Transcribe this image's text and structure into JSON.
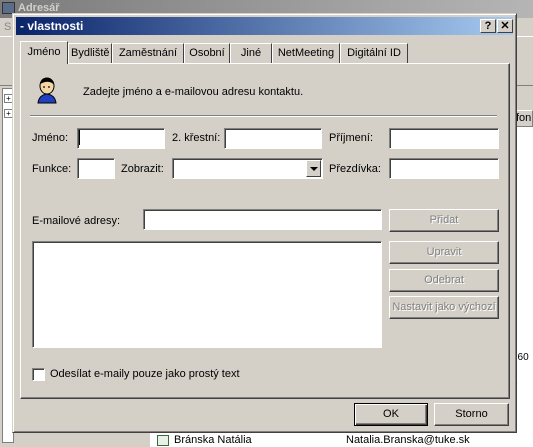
{
  "background": {
    "app_title": "Adresář",
    "menu_fragment": "S",
    "list_header_fragment": "fon",
    "list_fragment_1": ", 60",
    "list_fragment_2": "1",
    "bottom_row": {
      "name": "Bránska Natália",
      "email": "Natalia.Branska@tuke.sk"
    }
  },
  "dialog": {
    "title": "- vlastnosti",
    "help_button": "?",
    "close_button": "✕",
    "tabs": [
      {
        "label": "Jméno",
        "active": true
      },
      {
        "label": "Bydliště"
      },
      {
        "label": "Zaměstnání"
      },
      {
        "label": "Osobní"
      },
      {
        "label": "Jiné"
      },
      {
        "label": "NetMeeting"
      },
      {
        "label": "Digitální ID"
      }
    ],
    "intro_text": "Zadejte jméno a e-mailovou adresu kontaktu.",
    "fields": {
      "first_name": {
        "label": "Jméno:",
        "value": ""
      },
      "middle_name": {
        "label": "2. křestní:",
        "value": ""
      },
      "last_name": {
        "label": "Příjmení:",
        "value": ""
      },
      "title": {
        "label": "Funkce:",
        "value": ""
      },
      "display": {
        "label": "Zobrazit:",
        "value": ""
      },
      "nickname": {
        "label": "Přezdívka:",
        "value": ""
      },
      "email": {
        "label": "E-mailové adresy:",
        "value": ""
      }
    },
    "buttons": {
      "add": "Přidat",
      "edit": "Upravit",
      "remove": "Odebrat",
      "set_default": "Nastavit jako výchozí",
      "ok": "OK",
      "cancel": "Storno"
    },
    "plain_text_checkbox": {
      "label": "Odesílat e-maily pouze jako prostý text",
      "checked": false
    }
  }
}
